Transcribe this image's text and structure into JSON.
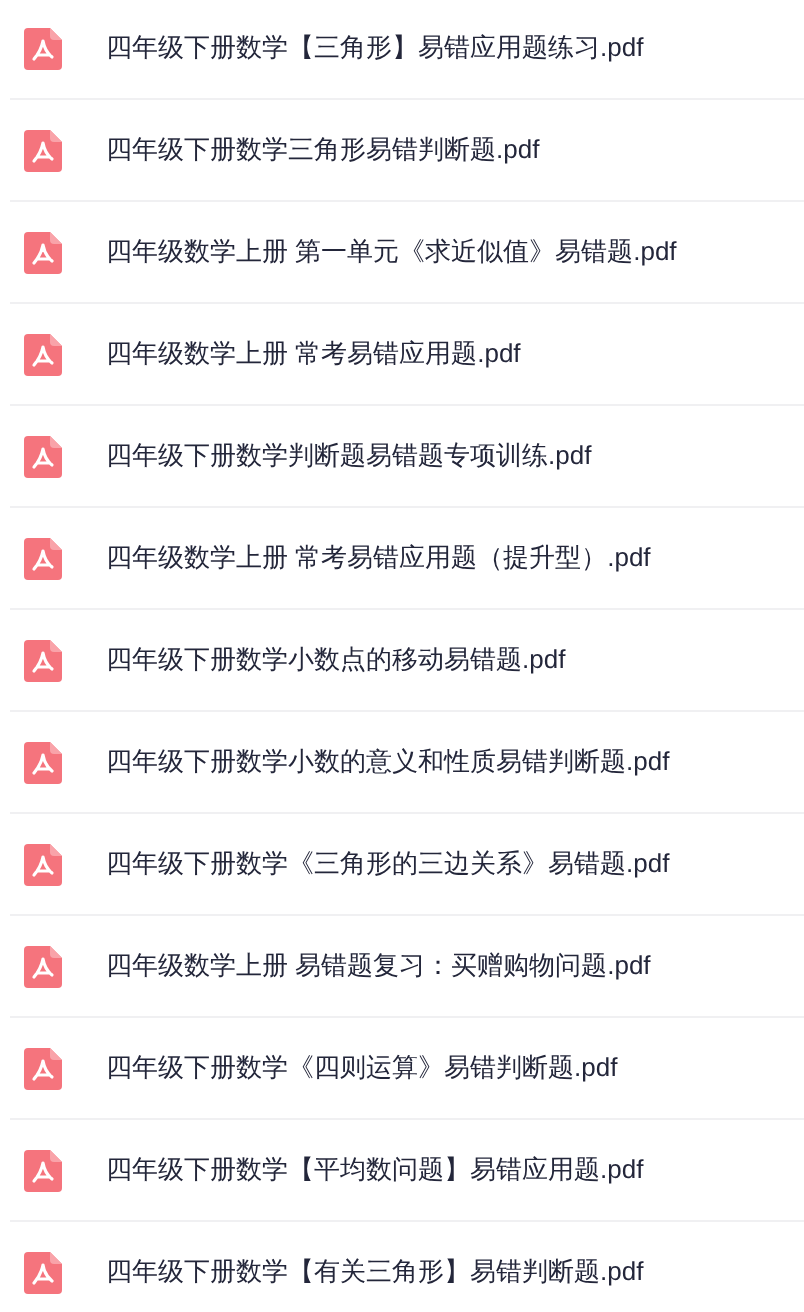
{
  "files": [
    {
      "name": "四年级下册数学【三角形】易错应用题练习.pdf"
    },
    {
      "name": "四年级下册数学三角形易错判断题.pdf"
    },
    {
      "name": "四年级数学上册 第一单元《求近似值》易错题.pdf"
    },
    {
      "name": "四年级数学上册 常考易错应用题.pdf"
    },
    {
      "name": "四年级下册数学判断题易错题专项训练.pdf"
    },
    {
      "name": "四年级数学上册 常考易错应用题（提升型）.pdf"
    },
    {
      "name": "四年级下册数学小数点的移动易错题.pdf"
    },
    {
      "name": "四年级下册数学小数的意义和性质易错判断题.pdf"
    },
    {
      "name": "四年级下册数学《三角形的三边关系》易错题.pdf"
    },
    {
      "name": "四年级数学上册 易错题复习：买赠购物问题.pdf"
    },
    {
      "name": "四年级下册数学《四则运算》易错判断题.pdf"
    },
    {
      "name": "四年级下册数学【平均数问题】易错应用题.pdf"
    },
    {
      "name": "四年级下册数学【有关三角形】易错判断题.pdf"
    }
  ]
}
